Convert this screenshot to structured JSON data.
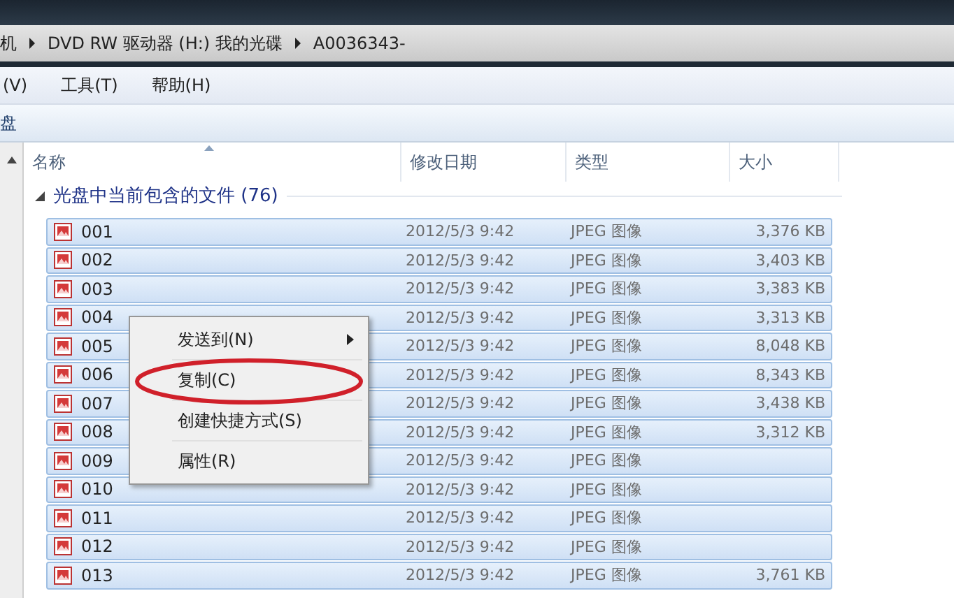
{
  "address": {
    "crumbs": [
      {
        "text": "机"
      },
      {
        "text": "DVD RW 驱动器 (H:) 我的光碟"
      },
      {
        "text": "A0036343-"
      }
    ]
  },
  "menu": [
    {
      "label": "(V)"
    },
    {
      "label": "工具(T)"
    },
    {
      "label": "帮助(H)"
    }
  ],
  "toolbar": [
    {
      "label": "盘"
    }
  ],
  "columns": [
    {
      "label": "名称",
      "sorted": true
    },
    {
      "label": "修改日期",
      "sorted": false
    },
    {
      "label": "类型",
      "sorted": false
    },
    {
      "label": "大小",
      "sorted": false
    }
  ],
  "group": {
    "title": "光盘中当前包含的文件 (76)",
    "expanded": true
  },
  "rows": [
    {
      "name": "001",
      "date": "2012/5/3 9:42",
      "type": "JPEG 图像",
      "size": "3,376 KB",
      "selected": true
    },
    {
      "name": "002",
      "date": "2012/5/3 9:42",
      "type": "JPEG 图像",
      "size": "3,403 KB",
      "selected": true
    },
    {
      "name": "003",
      "date": "2012/5/3 9:42",
      "type": "JPEG 图像",
      "size": "3,383 KB",
      "selected": true
    },
    {
      "name": "004",
      "date": "2012/5/3 9:42",
      "type": "JPEG 图像",
      "size": "3,313 KB",
      "selected": true
    },
    {
      "name": "005",
      "date": "2012/5/3 9:42",
      "type": "JPEG 图像",
      "size": "8,048 KB",
      "selected": true
    },
    {
      "name": "006",
      "date": "2012/5/3 9:42",
      "type": "JPEG 图像",
      "size": "8,343 KB",
      "selected": true
    },
    {
      "name": "007",
      "date": "2012/5/3 9:42",
      "type": "JPEG 图像",
      "size": "3,438 KB",
      "selected": true
    },
    {
      "name": "008",
      "date": "2012/5/3 9:42",
      "type": "JPEG 图像",
      "size": "3,312 KB",
      "selected": true
    },
    {
      "name": "009",
      "date": "2012/5/3 9:42",
      "type": "JPEG 图像",
      "selected": true
    },
    {
      "name": "010",
      "date": "2012/5/3 9:42",
      "type": "JPEG 图像",
      "selected": true
    },
    {
      "name": "011",
      "date": "2012/5/3 9:42",
      "type": "JPEG 图像",
      "selected": true
    },
    {
      "name": "012",
      "date": "2012/5/3 9:42",
      "type": "JPEG 图像",
      "selected": true
    },
    {
      "name": "013",
      "date": "2012/5/3 9:42",
      "type": "JPEG 图像",
      "size": "3,761 KB",
      "selected": true
    }
  ],
  "context_menu": {
    "items": [
      {
        "kind": "submenu",
        "label": "发送到(N)",
        "circled": false
      },
      {
        "kind": "separator"
      },
      {
        "kind": "item",
        "label": "复制(C)",
        "circled": true
      },
      {
        "kind": "separator"
      },
      {
        "kind": "item",
        "label": "创建快捷方式(S)",
        "circled": false
      },
      {
        "kind": "separator"
      },
      {
        "kind": "item",
        "label": "属性(R)",
        "circled": false
      }
    ]
  }
}
